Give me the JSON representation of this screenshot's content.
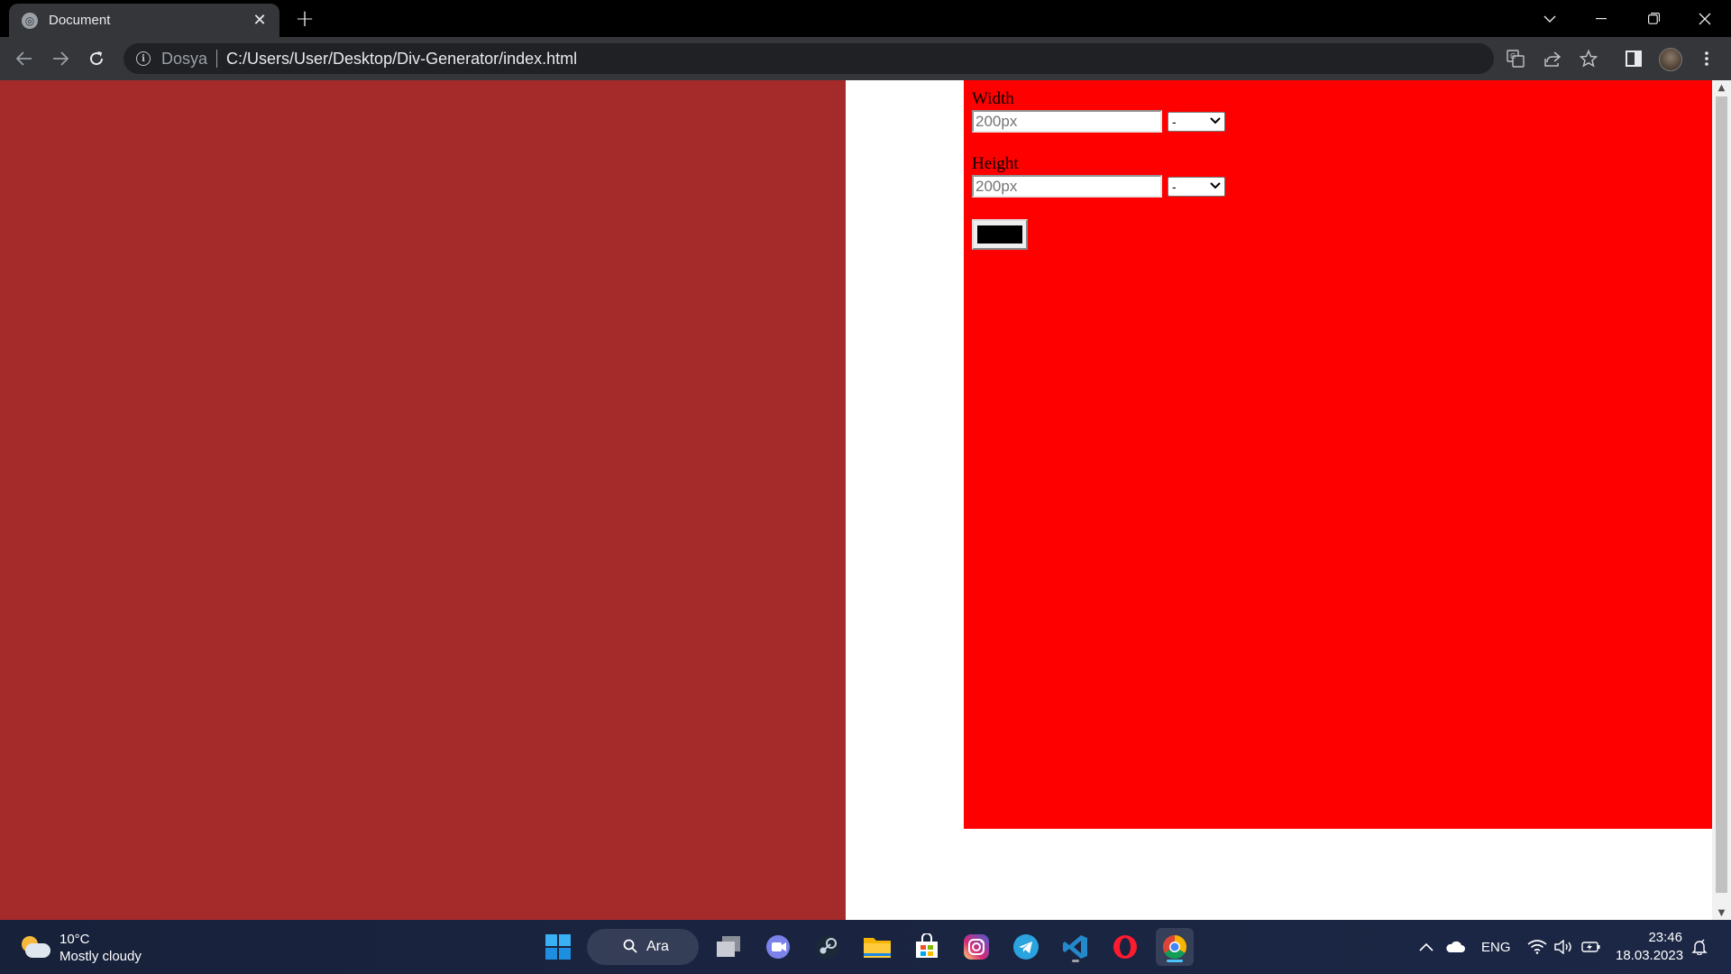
{
  "browser": {
    "tab_title": "Document",
    "url_scheme": "Dosya",
    "url": "C:/Users/User/Desktop/Div-Generator/index.html"
  },
  "page": {
    "left_color": "#a52a2a",
    "panel_color": "#ff0000",
    "width_label": "Width",
    "width_placeholder": "200px",
    "width_unit": "-",
    "height_label": "Height",
    "height_placeholder": "200px",
    "height_unit": "-",
    "color_value": "#000000"
  },
  "taskbar": {
    "temperature": "10°C",
    "weather_desc": "Mostly cloudy",
    "search_label": "Ara",
    "language": "ENG",
    "time": "23:46",
    "date": "18.03.2023",
    "apps": [
      "windows-start",
      "search",
      "task-view",
      "teams",
      "steam",
      "file-explorer",
      "microsoft-store",
      "instagram",
      "telegram",
      "vscode",
      "opera",
      "chrome"
    ]
  }
}
